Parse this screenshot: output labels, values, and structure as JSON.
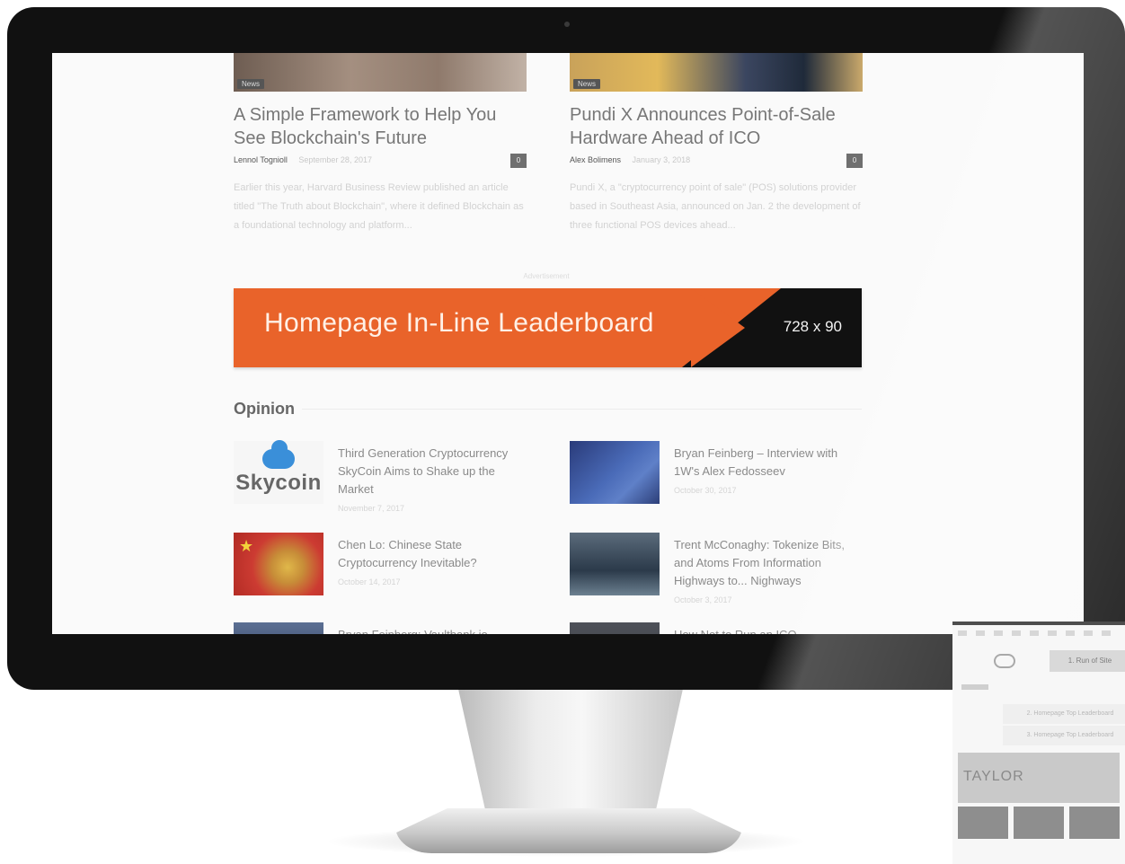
{
  "featured": [
    {
      "badge": "News",
      "title": "A Simple Framework to Help You See Blockchain's Future",
      "author": "Lennol Tognioll",
      "date": "September 28, 2017",
      "comments": "0",
      "excerpt": "Earlier this year, Harvard Business Review published an article titled \"The Truth about Blockchain\", where it defined Blockchain as a foundational technology and platform..."
    },
    {
      "badge": "News",
      "title": "Pundi X Announces Point-of-Sale Hardware Ahead of ICO",
      "author": "Alex Bolimens",
      "date": "January 3, 2018",
      "comments": "0",
      "excerpt": "Pundi X, a \"cryptocurrency point of sale\" (POS) solutions provider based in Southeast Asia, announced on Jan. 2 the development of three functional POS devices ahead..."
    }
  ],
  "ad": {
    "label": "Advertisement",
    "text": "Homepage In-Line Leaderboard",
    "size": "728 x 90"
  },
  "opinion": {
    "section_title": "Opinion",
    "logo_text": "Skycoin",
    "items": [
      {
        "title": "Third Generation Cryptocurrency SkyCoin Aims to Shake up the Market",
        "date": "November 7, 2017"
      },
      {
        "title": "Bryan Feinberg – Interview with 1W's Alex Fedosseev",
        "date": "October 30, 2017"
      },
      {
        "title": "Chen Lo: Chinese State Cryptocurrency Inevitable?",
        "date": "October 14, 2017"
      },
      {
        "title": "Trent McConaghy: Tokenize Bits, and Atoms From Information Highways to... Nighways",
        "date": "October 3, 2017"
      },
      {
        "title": "Bryan Feinberg: Vaultbank.io",
        "date": ""
      },
      {
        "title": "How Not to Run an ICO",
        "date": ""
      }
    ]
  },
  "side_panel": {
    "button": "1. Run of Site",
    "rows": [
      "2. Homepage Top Leaderboard",
      "3. Homepage Top Leaderboard"
    ],
    "brand": "TAYLOR"
  },
  "icons": {
    "apple": "apple-logo-icon",
    "comment": "comment-count-icon",
    "cloud": "cloud-icon",
    "star": "star-icon"
  },
  "colors": {
    "ad_orange": "#e9632a",
    "ad_black": "#111111",
    "bezel": "#111111"
  }
}
